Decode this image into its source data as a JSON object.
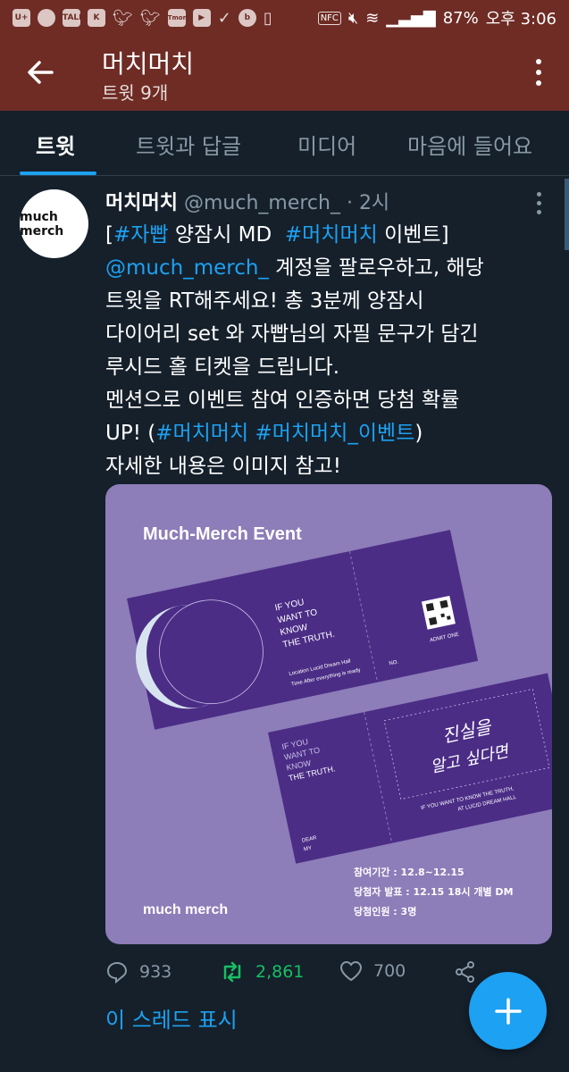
{
  "status_bar": {
    "left_icons": [
      "U+",
      "circle",
      "TALK",
      "K",
      "twitter",
      "twitter",
      "T money",
      "youtube",
      "check",
      "b",
      "battery-saver"
    ],
    "right_icons": [
      "NFC",
      "mute",
      "wifi",
      "signal"
    ],
    "battery": "87%",
    "time": "오후 3:06"
  },
  "appbar": {
    "title": "머치머치",
    "subtitle": "트윗 9개"
  },
  "tabs": [
    {
      "label": "트윗"
    },
    {
      "label": "트윗과 답글"
    },
    {
      "label": "미디어"
    },
    {
      "label": "마음에 들어요"
    }
  ],
  "tweet": {
    "avatar_text": "much merch",
    "name": "머치머치",
    "handle": "@much_merch_",
    "time": "· 2시",
    "line1_a": "[",
    "line1_tag1": "#자빱",
    "line1_b": " 양잠시 MD  ",
    "line1_tag2": "#머치머치",
    "line1_c": " 이벤트]",
    "line2_mention": "@much_merch_",
    "line2_rest": " 계정을 팔로우하고, 해당",
    "line3": "트윗을 RT해주세요! 총 3분께 양잠시",
    "line4": "다이어리 set 와 자빱님의 자필 문구가 담긴",
    "line5": "루시드 홀 티켓을 드립니다.",
    "line6": "멘션으로 이벤트 참여 인증하면 당첨 확률",
    "line7_a": "UP! (",
    "line7_tag1": "#머치머치",
    "line7_sp": " ",
    "line7_tag2": "#머치머치_이벤트",
    "line7_b": ")",
    "line8": "자세한 내용은 이미지 참고!"
  },
  "card": {
    "heading": "Much-Merch Event",
    "ticket1_lines": [
      "IF YOU",
      "WANT TO",
      "KNOW",
      "THE TRUTH."
    ],
    "ticket1_location": "Location  Lucid Dream Hall",
    "ticket1_time": "Time  After everything is ready",
    "ticket1_no": "NO.",
    "admit": "ADMIT ONE",
    "ticket2_lines": [
      "IF YOU",
      "WANT TO",
      "KNOW",
      "THE TRUTH."
    ],
    "ticket2_dear": "DEAR",
    "ticket2_my": "MY",
    "handwriting1": "진실을",
    "handwriting2": "알고 싶다면",
    "ticket2_footer1": "IF YOU WANT TO KNOW THE TRUTH,",
    "ticket2_footer2": "AT LUCID DREAM HALL",
    "info1": "참여기간 : 12.8~12.15",
    "info2": "당첨자 발표 : 12.15 18시 개별 DM",
    "info3": "당첨인원 : 3명",
    "brand": "much merch"
  },
  "stats": {
    "replies": "933",
    "retweets": "2,861",
    "likes": "700"
  },
  "thread_link": "이 스레드 표시",
  "colors": {
    "statusbar": "#6e2c25",
    "background": "#15202b",
    "accent": "#1da1f2",
    "retweet": "#17bf63",
    "card_bg": "#8d7db8",
    "ticket": "#4b2d86"
  }
}
